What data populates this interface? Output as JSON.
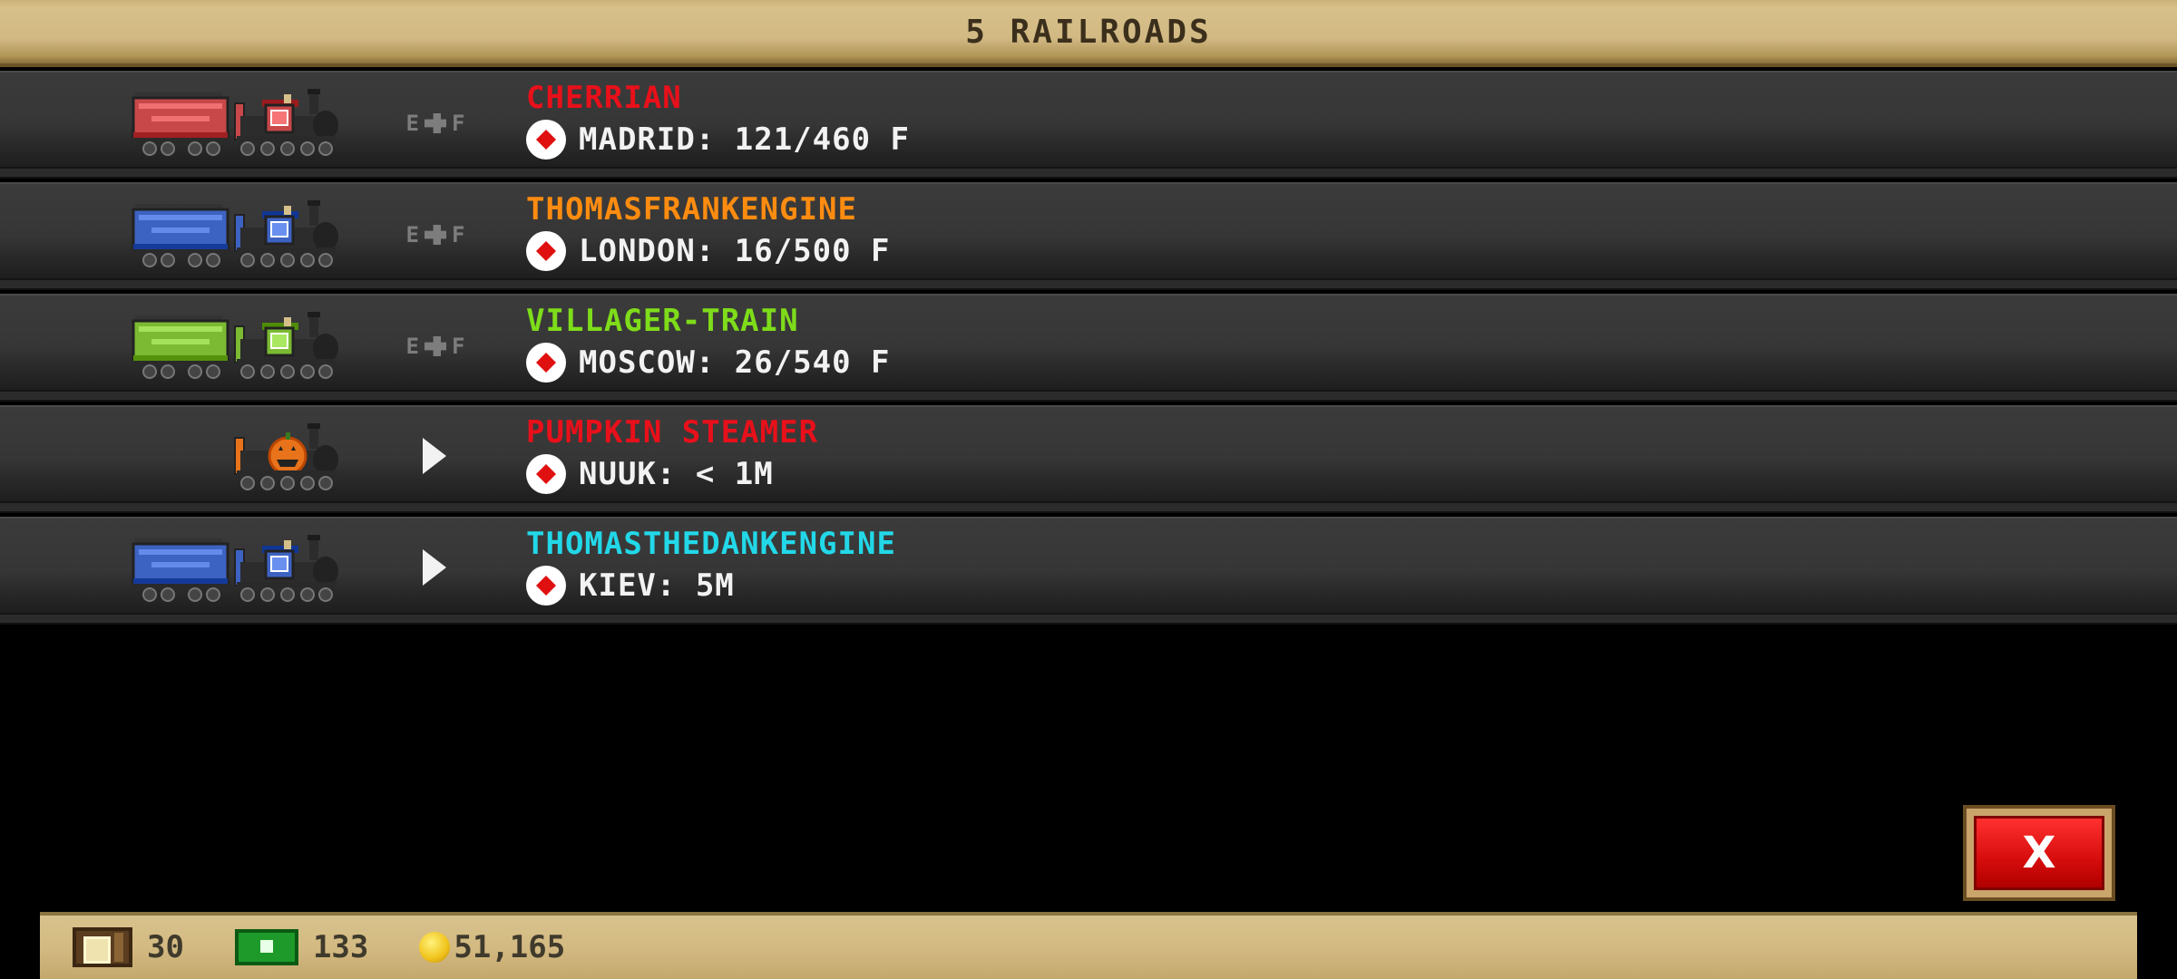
{
  "header": {
    "title": "5 RAILROADS"
  },
  "railroads": [
    {
      "name": "CHERRIAN",
      "name_color": "#e8101a",
      "train_color": "#c8484a",
      "has_car": true,
      "control": "E F",
      "control_type": "fuel",
      "destination": "MADRID: 121/460 F"
    },
    {
      "name": "THOMASFRANKENGINE",
      "name_color": "#ff8c10",
      "train_color": "#3d63c2",
      "has_car": true,
      "control": "E F",
      "control_type": "fuel",
      "destination": "LONDON: 16/500 F"
    },
    {
      "name": "VILLAGER-TRAIN",
      "name_color": "#7edc1a",
      "train_color": "#7cba34",
      "has_car": true,
      "control": "E F",
      "control_type": "fuel",
      "destination": "MOSCOW: 26/540 F"
    },
    {
      "name": "PUMPKIN STEAMER",
      "name_color": "#e8101a",
      "train_color": "#e8731a",
      "has_car": false,
      "control": "",
      "control_type": "play",
      "destination": "NUUK: < 1M"
    },
    {
      "name": "THOMASTHEDANKENGINE",
      "name_color": "#22d8e8",
      "train_color": "#3d63c2",
      "has_car": true,
      "control": "",
      "control_type": "play",
      "destination": "KIEV: 5M"
    }
  ],
  "footer": {
    "crates": "30",
    "cash": "133",
    "coins": "51,165"
  },
  "close_button": {
    "label": "X"
  },
  "icons": [
    "crate-icon",
    "cash-icon",
    "coin-icon",
    "location-pin-icon",
    "fuel-gauge-icon",
    "play-icon",
    "close-icon"
  ]
}
